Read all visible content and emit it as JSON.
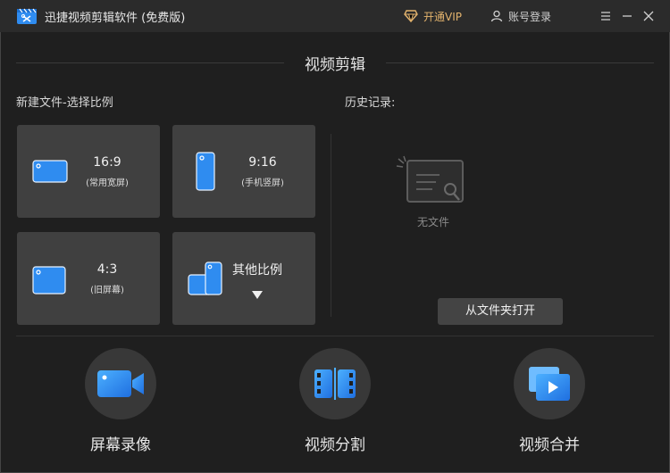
{
  "window": {
    "title": "迅捷视频剪辑软件 (免费版)",
    "vip_label": "开通VIP",
    "login_label": "账号登录"
  },
  "main": {
    "title": "视频剪辑",
    "new_file_label": "新建文件-选择比例",
    "history_label": "历史记录:"
  },
  "ratios": [
    {
      "ratio": "16:9",
      "desc": "(常用宽屏)"
    },
    {
      "ratio": "9:16",
      "desc": "(手机竖屏)"
    },
    {
      "ratio": "4:3",
      "desc": "(旧屏幕)"
    },
    {
      "ratio": "其他比例",
      "desc": ""
    }
  ],
  "history": {
    "empty_text": "无文件",
    "open_button": "从文件夹打开"
  },
  "tools": [
    {
      "label": "屏幕录像",
      "icon": "video-camera-icon"
    },
    {
      "label": "视频分割",
      "icon": "film-split-icon"
    },
    {
      "label": "视频合并",
      "icon": "video-merge-icon"
    }
  ],
  "colors": {
    "accent_blue": "#2f8cf0",
    "vip_gold": "#e3b36d",
    "card_bg": "#404040",
    "window_bg": "#1f1f1f"
  }
}
